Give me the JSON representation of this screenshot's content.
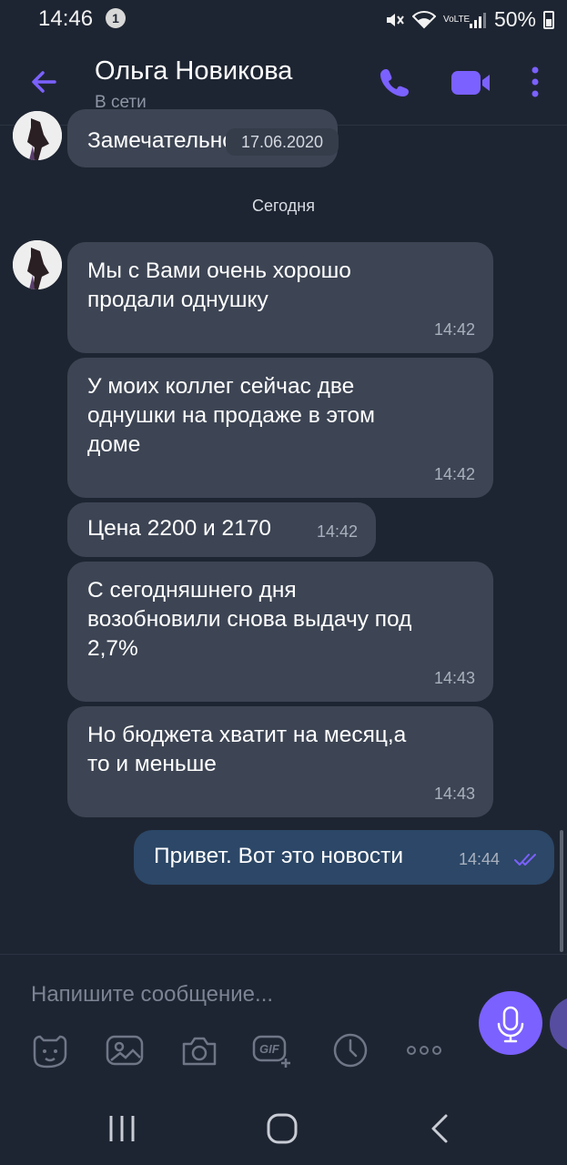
{
  "status_bar": {
    "time": "14:46",
    "notification_count": "1",
    "battery": "50%",
    "network": "VoLTE"
  },
  "header": {
    "contact_name": "Ольга Новикова",
    "contact_status": "В сети"
  },
  "chat": {
    "previous_message": "Замечательно",
    "previous_date": "17.06.2020",
    "day_separator": "Сегодня",
    "messages": [
      {
        "line1": "Мы с Вами очень хорошо",
        "line2": "продали однушку",
        "time": "14:42",
        "direction": "incoming"
      },
      {
        "line1": "У моих коллег сейчас две",
        "line2": "однушки на продаже в этом",
        "line3": "доме",
        "time": "14:42",
        "direction": "incoming"
      },
      {
        "line1": "Цена 2200 и 2170",
        "time": "14:42",
        "direction": "incoming"
      },
      {
        "line1": "С сегодняшнего дня",
        "line2": "возобновили снова выдачу под",
        "line3": "2,7%",
        "time": "14:43",
        "direction": "incoming"
      },
      {
        "line1": "Но бюджета хватит на месяц,а",
        "line2": "то и меньше",
        "time": "14:43",
        "direction": "incoming"
      },
      {
        "line1": "Привет. Вот это новости",
        "time": "14:44",
        "direction": "outgoing",
        "status": "read"
      }
    ]
  },
  "composer": {
    "placeholder": "Напишите сообщение...",
    "gif_label": "GIF",
    "toolbar_icons": [
      "sticker-icon",
      "gallery-icon",
      "camera-icon",
      "gif-icon",
      "timer-icon",
      "more-options-icon"
    ]
  },
  "colors": {
    "background": "#1e2532",
    "incoming_bubble": "#3d4554",
    "outgoing_bubble": "#2c4767",
    "accent": "#7b61ff"
  }
}
